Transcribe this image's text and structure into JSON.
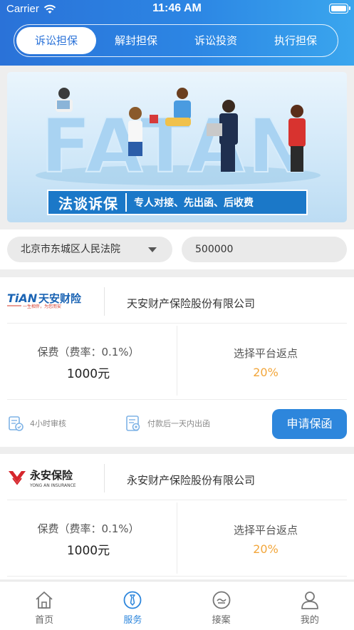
{
  "status_bar": {
    "carrier": "Carrier",
    "time": "11:46 AM"
  },
  "top_tabs": [
    {
      "label": "诉讼担保",
      "active": true
    },
    {
      "label": "解封担保",
      "active": false
    },
    {
      "label": "诉讼投资",
      "active": false
    },
    {
      "label": "执行担保",
      "active": false
    }
  ],
  "banner": {
    "big_text": "FATAN",
    "title": "法谈诉保",
    "slogan": "专人对接、先出函、后收费"
  },
  "filter": {
    "court": "北京市东城区人民法院",
    "amount": "500000"
  },
  "cards": [
    {
      "logo_text": "TiAN 天安财险",
      "logo_sub": "一生相伴，为您而安",
      "company": "天安财产保险股份有限公司",
      "fee_label": "保费（费率：0.1%）",
      "fee_value": "1000元",
      "rebate_label": "选择平台返点",
      "rebate_value": "20%",
      "review": "4小时审核",
      "issue": "付款后一天内出函",
      "apply_label": "申请保函"
    },
    {
      "logo_text": "永安保险",
      "logo_sub": "YONG AN INSURANCE",
      "company": "永安财产保险股份有限公司",
      "fee_label": "保费（费率：0.1%）",
      "fee_value": "1000元",
      "rebate_label": "选择平台返点",
      "rebate_value": "20%"
    }
  ],
  "bottom_tabs": [
    {
      "label": "首页",
      "icon": "home-icon",
      "active": false
    },
    {
      "label": "服务",
      "icon": "service-icon",
      "active": true
    },
    {
      "label": "接案",
      "icon": "case-icon",
      "active": false
    },
    {
      "label": "我的",
      "icon": "profile-icon",
      "active": false
    }
  ],
  "colors": {
    "primary": "#2d86dc",
    "accent": "#f2a63b"
  }
}
